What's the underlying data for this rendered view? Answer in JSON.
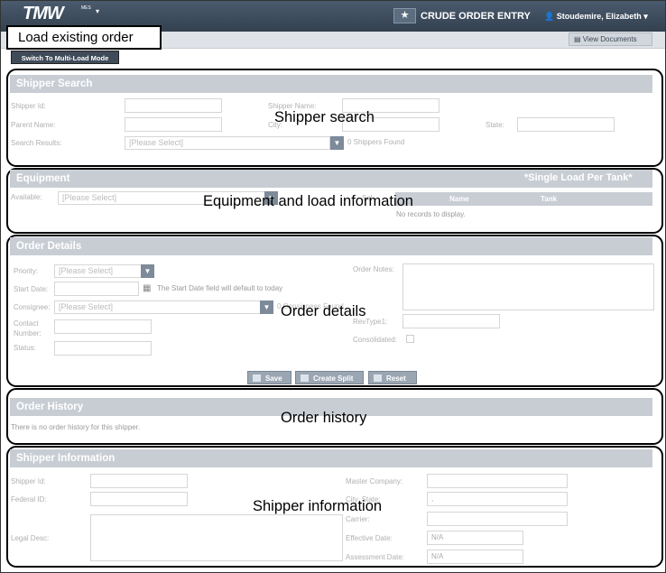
{
  "header": {
    "logo": "TMW",
    "logo_sub": "MES",
    "app_title": "CRUDE ORDER ENTRY",
    "user_name": "Stoudemire, Elizabeth",
    "view_documents": "View Documents"
  },
  "callouts": {
    "load_existing": "Load existing order",
    "shipper_search": "Shipper search",
    "equipment": "Equipment and load information",
    "order_details": "Order details",
    "order_history": "Order history",
    "shipper_info": "Shipper information"
  },
  "toolbar": {
    "multi_load": "Switch To Multi-Load Mode"
  },
  "shipper_search": {
    "title": "Shipper Search",
    "shipper_id": "Shipper Id:",
    "shipper_name": "Shipper Name:",
    "parent_name": "Parent Name:",
    "city": "City:",
    "state": "State:",
    "search_results": "Search Results:",
    "results_select": "[Please Select]",
    "found": "0 Shippers Found"
  },
  "equipment": {
    "title": "Equipment",
    "note": "*Single Load Per Tank*",
    "available": "Available:",
    "available_select": "[Please Select]",
    "selected": "Sel",
    "col_name": "Name",
    "col_tank": "Tank",
    "no_records": "No records to display."
  },
  "order_details": {
    "title": "Order Details",
    "priority": "Priority:",
    "priority_select": "[Please Select]",
    "start_date": "Start Date:",
    "start_note": "The Start Date field will default to today",
    "consignee": "Consignee:",
    "consignee_select": "[Please Select]",
    "consignee_found": "0 Consignees Found",
    "contact_1": "Contact",
    "contact_2": "Number:",
    "status": "Status:",
    "order_notes": "Order Notes:",
    "revtype": "RevType1:",
    "consolidated": "Consolidated:",
    "save": "Save",
    "create_split": "Create Split",
    "reset": "Reset"
  },
  "order_history": {
    "title": "Order History",
    "empty": "There is no order history for this shipper."
  },
  "shipper_info": {
    "title": "Shipper Information",
    "shipper_id": "Shipper Id:",
    "federal_id": "Federal ID:",
    "legal_desc": "Legal Desc:",
    "master_company": "Master Company:",
    "city_state": "City, State:",
    "carrier": "Carrier:",
    "effective_date": "Effective Date:",
    "effective_val": "N/A",
    "assessment_date": "Assessment Date:",
    "assessment_val": "N/A",
    "city_state_val": ","
  },
  "colors": {
    "header_bg": "#3b4858",
    "panel_bar": "#c8cdd4",
    "callout_border": "#000000"
  },
  "icons": [
    "star-icon",
    "user-icon",
    "document-icon",
    "calendar-icon",
    "save-icon",
    "split-icon",
    "reset-icon",
    "chevron-down-icon"
  ]
}
